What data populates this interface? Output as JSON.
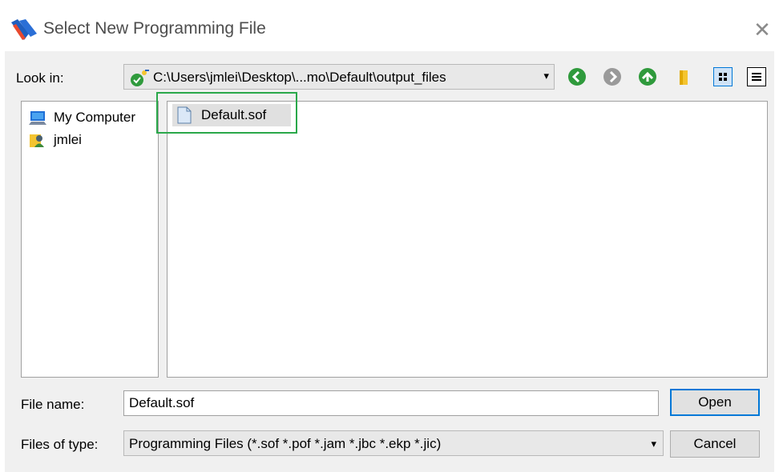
{
  "window": {
    "title": "Select New Programming File",
    "close_glyph": "✕"
  },
  "toolbar": {
    "look_in_label": "Look in:",
    "path": "C:\\Users\\jmlei\\Desktop\\...mo\\Default\\output_files",
    "combo_arrow": "▾",
    "buttons": [
      "back-icon",
      "forward-icon",
      "up-icon",
      "new-folder-icon",
      "list-view-icon",
      "detail-view-icon"
    ]
  },
  "sidebar": {
    "items": [
      {
        "label": "My Computer",
        "icon": "computer-icon"
      },
      {
        "label": "jmlei",
        "icon": "user-icon"
      }
    ]
  },
  "files": {
    "items": [
      {
        "label": "Default.sof",
        "icon": "file-icon",
        "selected": true
      }
    ]
  },
  "form": {
    "file_name_label": "File name:",
    "file_name_value": "Default.sof",
    "files_of_type_label": "Files of type:",
    "files_of_type_value": "Programming Files (*.sof *.pof *.jam *.jbc *.ekp *.jic)",
    "type_arrow": "▾"
  },
  "buttons": {
    "open": "Open",
    "cancel": "Cancel"
  },
  "colors": {
    "highlight": "#2aa84a",
    "nav_green": "#2f9a3c",
    "nav_disabled": "#9a9a9a",
    "folder_yellow": "#f4c430",
    "default_button_border": "#0078d7"
  }
}
